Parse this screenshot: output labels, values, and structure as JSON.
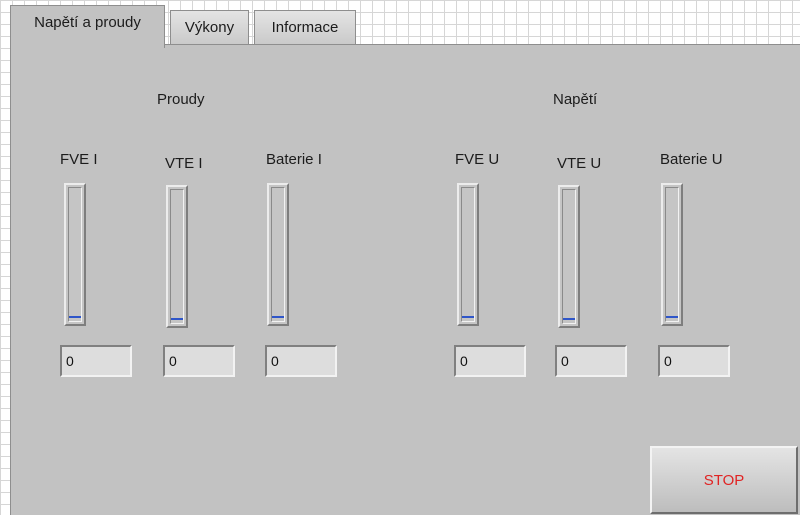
{
  "tabs": [
    {
      "label": "Napětí  a proudy",
      "active": true
    },
    {
      "label": "Výkony",
      "active": false
    },
    {
      "label": "Informace",
      "active": false
    }
  ],
  "groups": {
    "currents_title": "Proudy",
    "voltages_title": "Napětí"
  },
  "indicators": [
    {
      "label": "FVE I",
      "value": "0",
      "level": 0
    },
    {
      "label": "VTE I",
      "value": "0",
      "level": 0
    },
    {
      "label": "Baterie I",
      "value": "0",
      "level": 0
    },
    {
      "label": "FVE U",
      "value": "0",
      "level": 0
    },
    {
      "label": "VTE U",
      "value": "0",
      "level": 0
    },
    {
      "label": "Baterie U",
      "value": "0",
      "level": 0
    }
  ],
  "stop_button": {
    "label": "STOP",
    "color": "#e02424"
  },
  "colors": {
    "panel": "#c2c2c2",
    "level_marker": "#2f56c9"
  }
}
